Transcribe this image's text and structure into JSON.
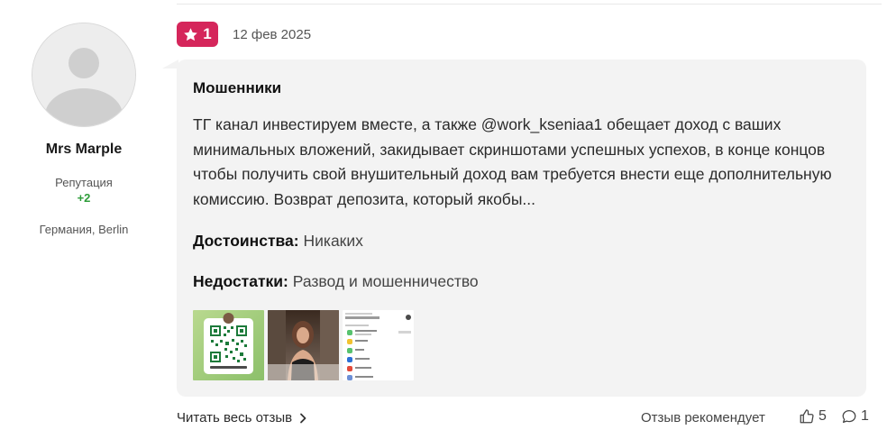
{
  "author": {
    "name": "Mrs Marple",
    "reputation_label": "Репутация",
    "reputation_value": "+2",
    "location": "Германия, Berlin"
  },
  "review": {
    "rating": "1",
    "date": "12 фев 2025",
    "title": "Мошенники",
    "text": "ТГ канал инвестируем вместе, а также @work_kseniaa1 обещает доход с ваших минимальных вложений, закидывает скриншотами успешных успехов, в конце концов чтобы получить свой внушительный доход вам требуется внести еще дополнительную комиссию. Возврат депозита, который якобы...",
    "pros_label": "Достоинства:",
    "pros_value": "Никаких",
    "cons_label": "Недостатки:",
    "cons_value": "Развод и мошенничество",
    "thumbnails": [
      {
        "kind": "qr-code",
        "caption": "@WORK_KSENIAA1"
      },
      {
        "kind": "photo"
      },
      {
        "kind": "app-screenshot"
      }
    ]
  },
  "footer": {
    "read_more": "Читать весь отзыв",
    "recommend": "Отзыв рекомендует",
    "likes": "5",
    "comments": "1"
  },
  "colors": {
    "rating_badge": "#d5265b",
    "reputation_positive": "#2e9d3a",
    "card_bg": "#f3f3f3"
  },
  "icons": {
    "rating": "star-icon",
    "read_more": "chevron-right-icon",
    "likes": "thumbs-up-icon",
    "comments": "comment-icon"
  }
}
